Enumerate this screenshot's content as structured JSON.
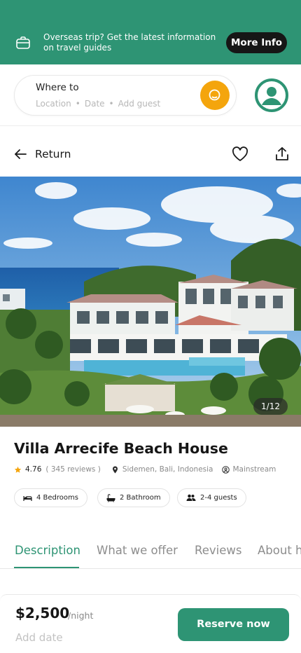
{
  "banner": {
    "text": "Overseas trip? Get the latest information on travel guides",
    "button_label": "More Info",
    "icon": "briefcase-icon",
    "background_color": "#2e9474"
  },
  "search": {
    "title": "Where to",
    "location_placeholder": "Location",
    "date_placeholder": "Date",
    "guest_placeholder": "Add guest",
    "separator": "•",
    "button_icon": "search-icon",
    "button_color": "#f4a50d"
  },
  "nav": {
    "return_label": "Return",
    "favorite_icon": "heart-icon",
    "share_icon": "share-icon"
  },
  "gallery": {
    "counter": "1/12"
  },
  "listing": {
    "title": "Villa Arrecife Beach House",
    "rating": "4.76",
    "reviews": "( 345 reviews )",
    "location": "Sidemen, Bali, Indonesia",
    "category": "Mainstream",
    "features": [
      {
        "icon": "bed-icon",
        "label": "4 Bedrooms"
      },
      {
        "icon": "bathtub-icon",
        "label": "2 Bathroom"
      },
      {
        "icon": "guests-icon",
        "label": "2-4 guests"
      }
    ]
  },
  "tabs": [
    {
      "label": "Description",
      "active": true
    },
    {
      "label": "What we offer",
      "active": false
    },
    {
      "label": "Reviews",
      "active": false
    },
    {
      "label": "About host",
      "active": false
    }
  ],
  "booking": {
    "price": "$2,500",
    "per_unit": "/night",
    "date_placeholder": "Add date",
    "reserve_label": "Reserve now"
  },
  "colors": {
    "accent": "#2e9474",
    "search_button": "#f4a50d",
    "star": "#f4a50d"
  }
}
